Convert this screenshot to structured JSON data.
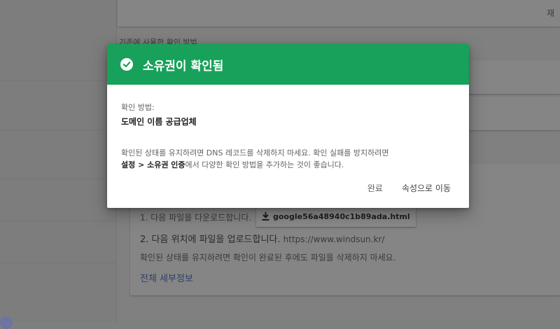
{
  "background": {
    "top_right_text": "재",
    "section_label": "기존에 사용한 확인 방법",
    "step1_text": "1. 다음 파일을 다운로드합니다.",
    "download_button": "google56a48940c1b89ada.html",
    "step2_label": "2. 다음 위치에 파일을 업로드합니다.",
    "step2_url": "https://www.windsun.kr/",
    "keep_note": "확인된 상태를 유지하려면 확인이 완료된 후에도 파일을 삭제하지 마세요.",
    "details_link": "전체 세부정보"
  },
  "dialog": {
    "title": "소유권이 확인됨",
    "method_label": "확인 방법:",
    "method_value": "도메인 이름 공급업체",
    "message_part1": "확인된 상태를 유지하려면 DNS 레코드를 삭제하지 마세요. 확인 실패를 방지하려면",
    "message_bold": "설정 > 소유권 인증",
    "message_part2": "에서 다양한 확인 방법을 추가하는 것이 좋습니다.",
    "done_button": "완료",
    "goto_button": "속성으로 이동"
  },
  "colors": {
    "header_green": "#18a15a",
    "overlay_gray": "#808080"
  }
}
